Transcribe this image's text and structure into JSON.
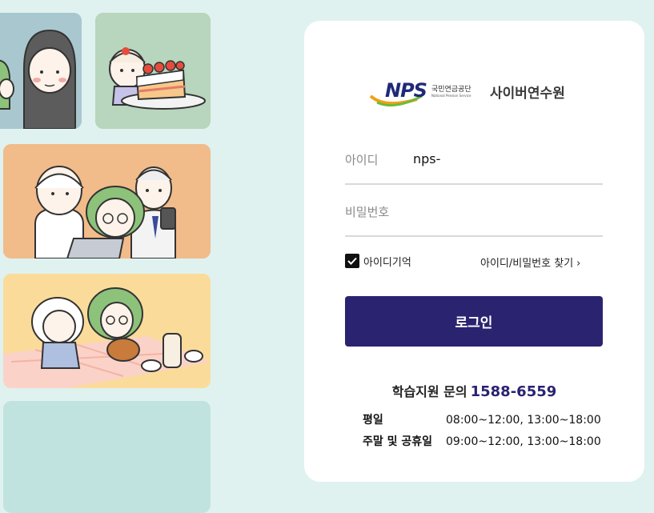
{
  "colors": {
    "background": "#dff2ef",
    "card": "#ffffff",
    "button": "#2a2370",
    "phone": "#2a2370"
  },
  "illustrations": [
    {
      "name": "hooded-girl-illustration"
    },
    {
      "name": "cake-girl-illustration"
    },
    {
      "name": "laptop-group-illustration"
    },
    {
      "name": "picnic-illustration"
    },
    {
      "name": "empty-tile"
    }
  ],
  "logo": {
    "mark": "NPS",
    "org_kr": "국민연금공단",
    "org_en": "National Pension Service",
    "title": "사이버연수원"
  },
  "login": {
    "id_label": "아이디",
    "id_value": "nps-",
    "pw_label": "비밀번호",
    "remember_label": "아이디기억",
    "remember_checked": true,
    "find_link": "아이디/비밀번호 찾기",
    "button_label": "로그인"
  },
  "support": {
    "label": "학습지원 문의",
    "phone": "1588-6559",
    "hours": [
      {
        "day": "평일",
        "time": "08:00~12:00, 13:00~18:00"
      },
      {
        "day": "주말 및 공휴일",
        "time": "09:00~12:00, 13:00~18:00"
      }
    ]
  }
}
